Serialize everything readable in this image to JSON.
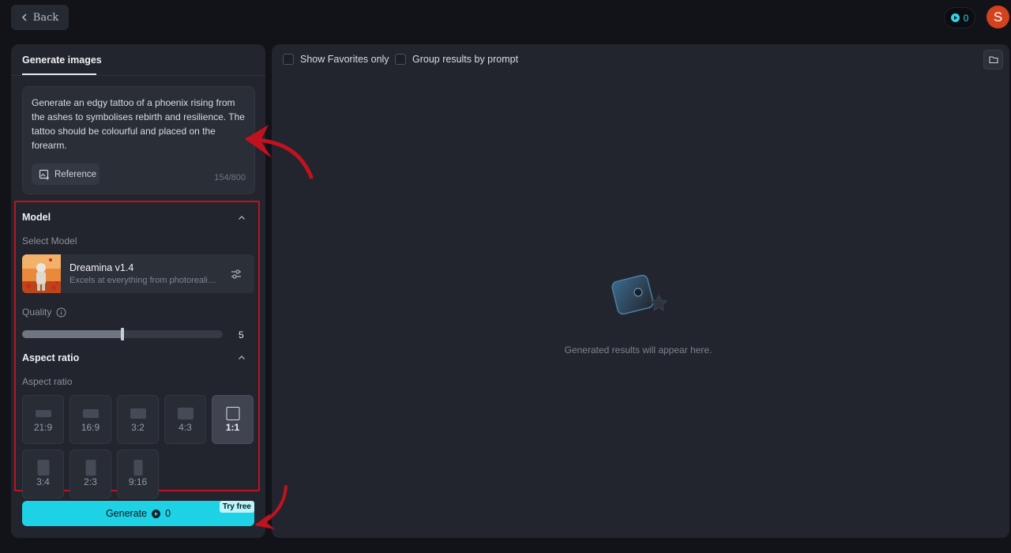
{
  "topbar": {
    "back_label": "Back",
    "credits": "0",
    "avatar_letter": "S"
  },
  "left_panel": {
    "tab_label": "Generate images",
    "prompt_text": "Generate an edgy tattoo of a phoenix rising from the ashes to symbolises rebirth and resilience. The tattoo should be colourful and placed on the forearm.",
    "reference_label": "Reference",
    "char_count": "154/800",
    "model": {
      "section_title": "Model",
      "select_label": "Select Model",
      "name": "Dreamina v1.4",
      "description": "Excels at everything from photorealism to painterly style..."
    },
    "quality": {
      "label": "Quality",
      "value": "5",
      "fraction": 0.5
    },
    "aspect": {
      "section_title": "Aspect ratio",
      "label": "Aspect ratio",
      "options": [
        "21:9",
        "16:9",
        "3:2",
        "4:3",
        "1:1",
        "3:4",
        "2:3",
        "9:16"
      ],
      "selected": "1:1"
    },
    "generate": {
      "label": "Generate",
      "cost": "0",
      "badge": "Try free"
    }
  },
  "right_panel": {
    "favorites_label": "Show Favorites only",
    "group_label": "Group results by prompt",
    "empty_text": "Generated results will appear here."
  },
  "colors": {
    "accent": "#1ed2e6",
    "annotation": "#c1121f",
    "avatar": "#d3421d"
  }
}
